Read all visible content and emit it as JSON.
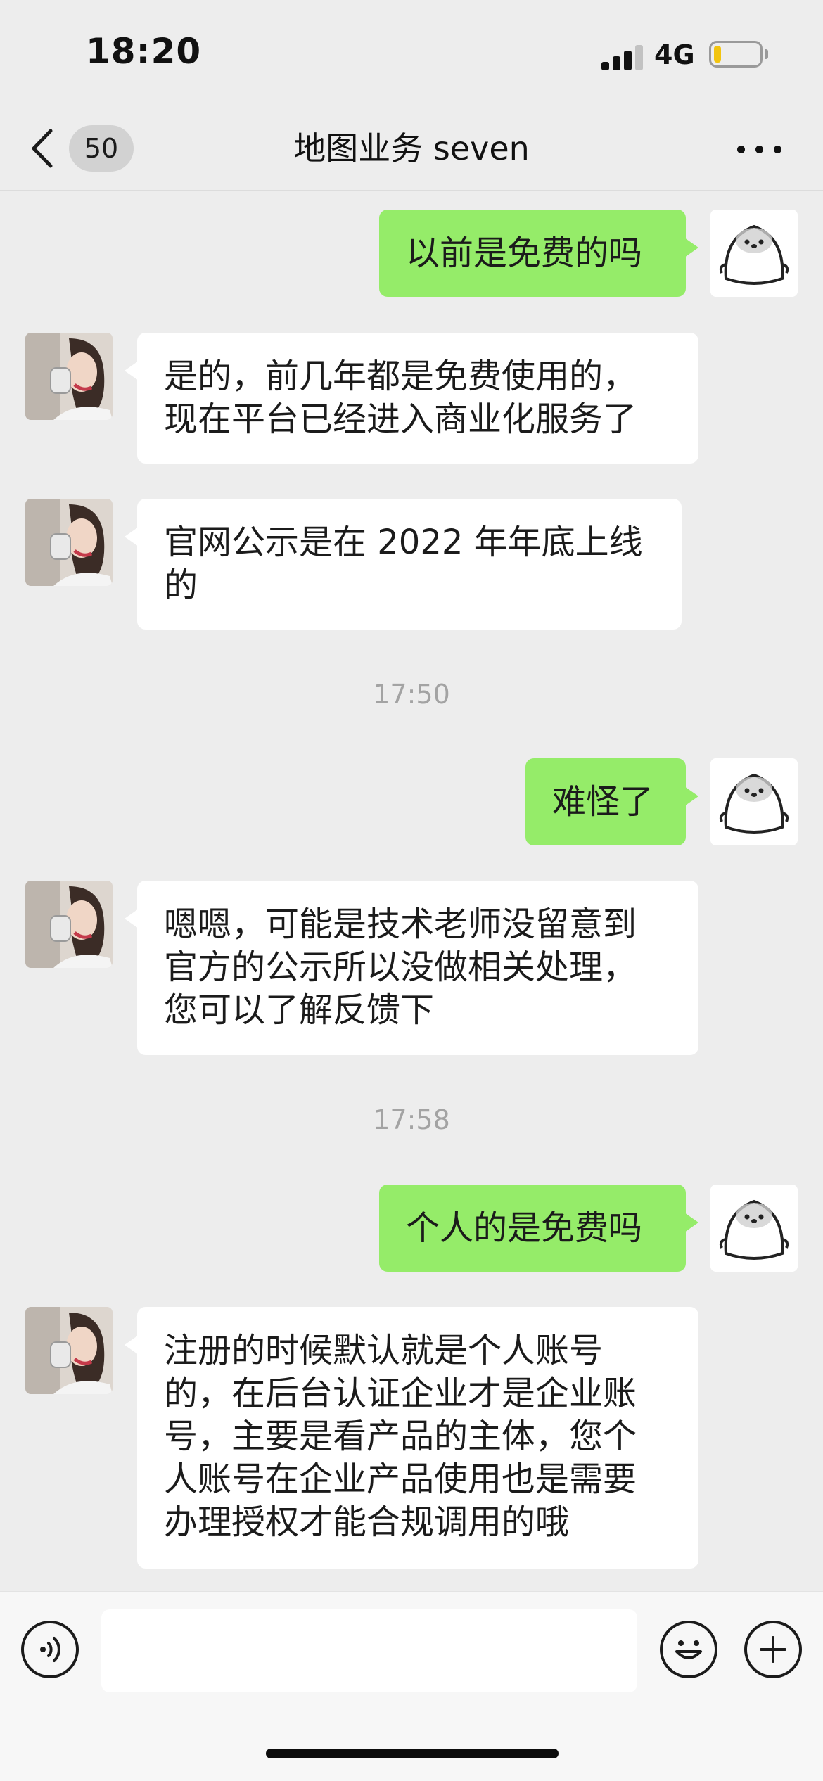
{
  "status_bar": {
    "time": "18:20",
    "network": "4G",
    "battery_level": 0.15,
    "battery_color": "#f2c40f"
  },
  "nav": {
    "back_icon": "chevron-left-icon",
    "unread_count": "50",
    "title": "地图业务 seven",
    "more_icon": "more-dots-icon"
  },
  "messages": [
    {
      "from": "self",
      "text": "以前是免费的吗"
    },
    {
      "from": "peer",
      "text": "是的，前几年都是免费使用的，\n现在平台已经进入商业化服务了"
    },
    {
      "from": "peer",
      "text": "官网公示是在 2022 年年底上线\n的"
    },
    {
      "time": "17:50"
    },
    {
      "from": "self",
      "text": "难怪了"
    },
    {
      "from": "peer",
      "text": "嗯嗯，可能是技术老师没留意到\n官方的公示所以没做相关处理，\n您可以了解反馈下"
    },
    {
      "time": "17:58"
    },
    {
      "from": "self",
      "text": "个人的是免费吗"
    },
    {
      "from": "peer",
      "text": "注册的时候默认就是个人账号\n的，在后台认证企业才是企业账\n号，主要是看产品的主体，您个\n人账号在企业产品使用也是需要\n办理授权才能合规调用的哦"
    }
  ],
  "input_bar": {
    "voice_icon": "voice-icon",
    "text_value": "",
    "emoji_icon": "emoji-icon",
    "plus_icon": "plus-icon"
  },
  "colors": {
    "background": "#ededed",
    "outgoing_bubble": "#95ec69",
    "incoming_bubble": "#ffffff",
    "timestamp": "#a3a3a3"
  }
}
